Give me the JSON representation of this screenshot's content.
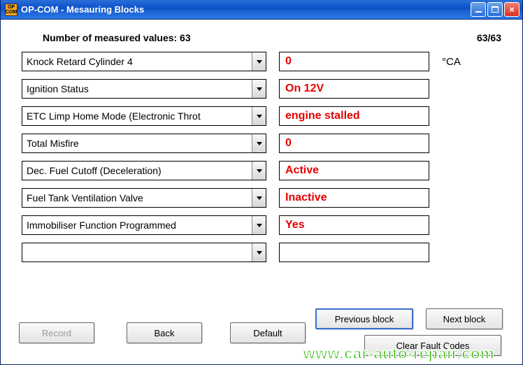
{
  "window": {
    "title": "OP-COM - Mesauring Blocks",
    "app_icon_label": "OP COM"
  },
  "header": {
    "measured_label": "Number of measured values: 63",
    "counter": "63/63"
  },
  "rows": [
    {
      "label": "Knock Retard Cylinder 4",
      "value": "0",
      "unit": "°CA"
    },
    {
      "label": "Ignition Status",
      "value": "On  12V",
      "unit": ""
    },
    {
      "label": "ETC Limp Home Mode (Electronic Throt",
      "value": "engine stalled",
      "unit": ""
    },
    {
      "label": "Total Misfire",
      "value": "0",
      "unit": ""
    },
    {
      "label": "Dec. Fuel Cutoff (Deceleration)",
      "value": "Active",
      "unit": ""
    },
    {
      "label": "Fuel Tank Ventilation Valve",
      "value": "Inactive",
      "unit": ""
    },
    {
      "label": "Immobiliser Function Programmed",
      "value": "Yes",
      "unit": ""
    },
    {
      "label": "",
      "value": "",
      "unit": ""
    }
  ],
  "buttons": {
    "record": "Record",
    "back": "Back",
    "default": "Default",
    "prev": "Previous block",
    "next": "Next block",
    "clear": "Clear Fault Codes"
  },
  "watermark": "www.car-auto-repair.com"
}
